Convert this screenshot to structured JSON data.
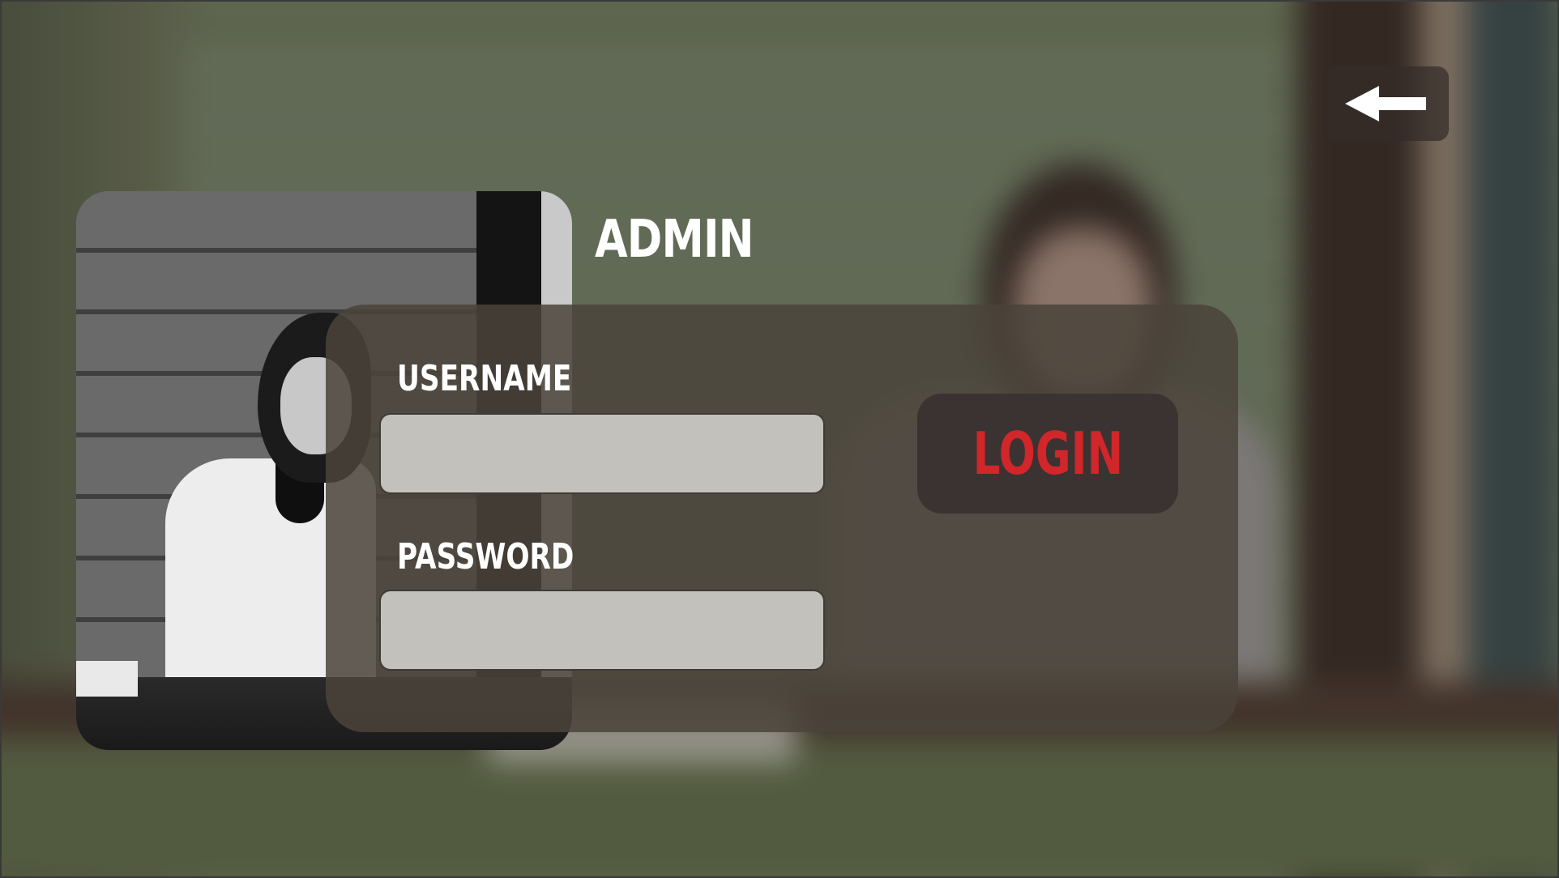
{
  "page": {
    "title": "ADMIN"
  },
  "header": {
    "back_icon": "left-arrow-icon"
  },
  "login_form": {
    "username_label": "USERNAME",
    "username_value": "",
    "password_label": "PASSWORD",
    "password_value": "",
    "login_label": "LOGIN"
  },
  "colors": {
    "login_text": "#d1262a",
    "button_bg": "#3b3331",
    "panel_bg": "#4a443a",
    "field_bg": "#c3c1bc"
  }
}
